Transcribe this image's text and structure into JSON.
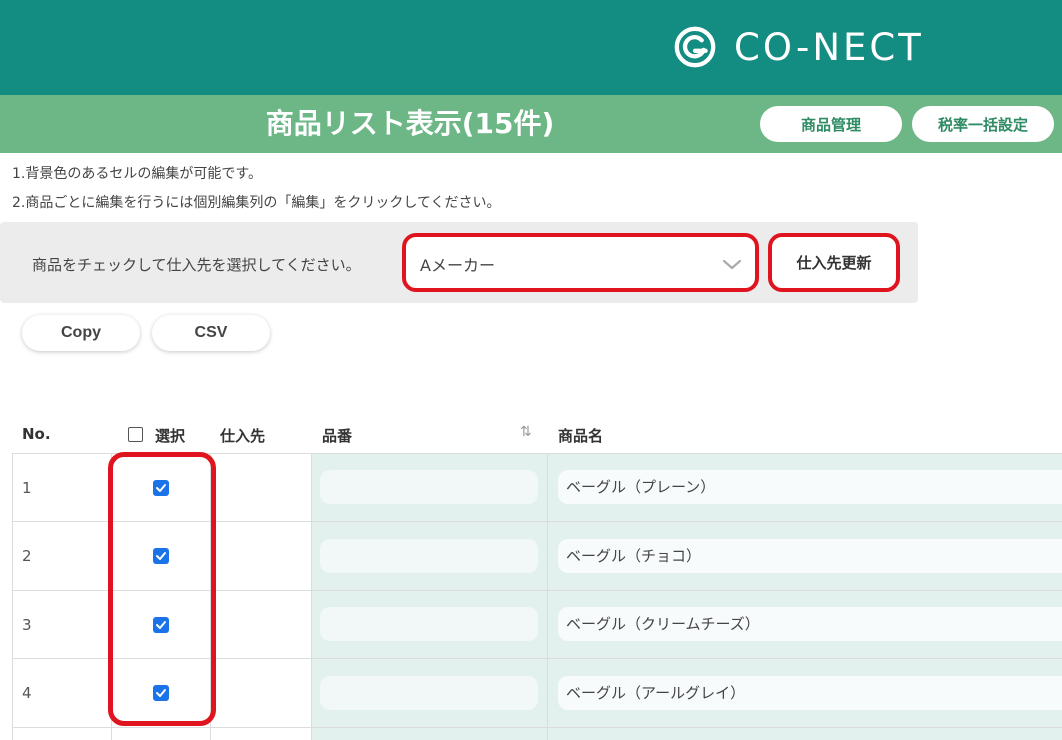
{
  "header": {
    "brand": "CO-NECT",
    "title": "商品リスト表示(15件)",
    "product_management_label": "商品管理",
    "tax_settings_label": "税率一括設定"
  },
  "notes": [
    "1.背景色のあるセルの編集が可能です。",
    "2.商品ごとに編集を行うには個別編集列の「編集」をクリックしてください。"
  ],
  "supplier": {
    "prompt": "商品をチェックして仕入先を選択してください。",
    "selected": "Aメーカー",
    "update_label": "仕入先更新"
  },
  "actions": {
    "copy_label": "Copy",
    "csv_label": "CSV"
  },
  "table": {
    "columns": {
      "no": "No.",
      "select": "選択",
      "supplier": "仕入先",
      "sku": "品番",
      "name": "商品名"
    },
    "rows": [
      {
        "no": "1",
        "checked": true,
        "supplier": "",
        "sku": "",
        "name": "ベーグル（プレーン）"
      },
      {
        "no": "2",
        "checked": true,
        "supplier": "",
        "sku": "",
        "name": "ベーグル（チョコ）"
      },
      {
        "no": "3",
        "checked": true,
        "supplier": "",
        "sku": "",
        "name": "ベーグル（クリームチーズ）"
      },
      {
        "no": "4",
        "checked": true,
        "supplier": "",
        "sku": "",
        "name": "ベーグル（アールグレイ）"
      }
    ]
  },
  "colors": {
    "topbar": "#138c81",
    "titlebar": "#6db787",
    "highlight": "#e0141e",
    "checkbox": "#1a73e8",
    "editable_cell": "#e2f0ee"
  },
  "icons": [
    "conect-logo-icon",
    "chevron-down-icon",
    "sort-icon",
    "check-icon"
  ]
}
